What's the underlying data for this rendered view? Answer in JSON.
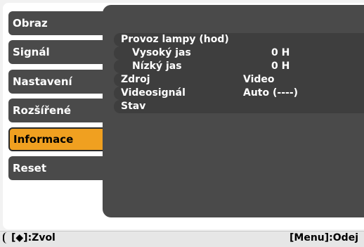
{
  "menu": {
    "items": [
      {
        "label": "Obraz"
      },
      {
        "label": "Signál"
      },
      {
        "label": "Nastavení"
      },
      {
        "label": "Rozšířené"
      },
      {
        "label": "Informace"
      },
      {
        "label": "Reset"
      }
    ],
    "selected": "Informace"
  },
  "info": {
    "rows": [
      {
        "label": "Provoz lampy (hod)",
        "value": ""
      },
      {
        "label": "Vysoký jas",
        "value": "0 H"
      },
      {
        "label": "Nízký jas",
        "value": "0 H"
      },
      {
        "label": "Zdroj",
        "value": "Video"
      },
      {
        "label": "Videosignál",
        "value": "Auto (----)"
      },
      {
        "label": "Stav",
        "value": ""
      }
    ]
  },
  "footer": {
    "left_hint": "[◆]:Zvol",
    "right_hint": "[Menu]:Odej"
  },
  "colors": {
    "panel_bg": "#4a4a4a",
    "selected_bg": "#f0a020",
    "text": "#ffffff"
  }
}
